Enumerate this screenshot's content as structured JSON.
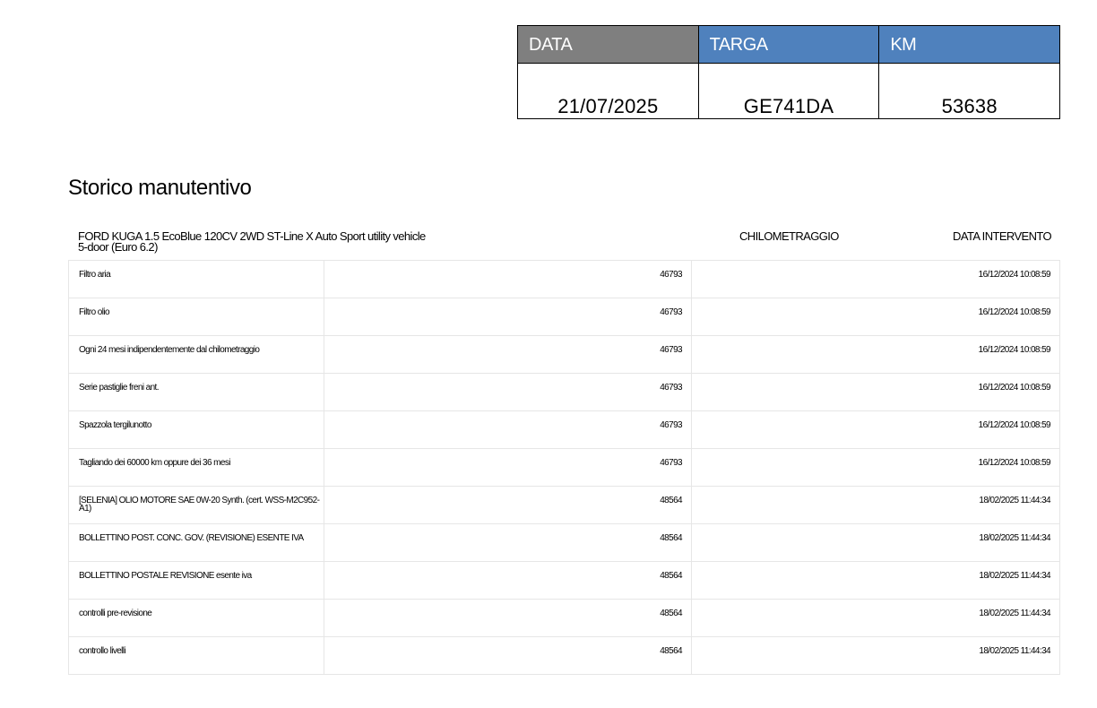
{
  "summary": {
    "date_label": "DATA",
    "plate_label": "TARGA",
    "km_label": "KM",
    "date_value": "21/07/2025",
    "plate_value": "GE741DA",
    "km_value": "53638",
    "colors": {
      "date_header": "#7f7f7f",
      "plate_header": "#4f81bd",
      "km_header": "#4f81bd"
    }
  },
  "section_title": "Storico manutentivo",
  "table": {
    "vehicle": "FORD KUGA 1.5 EcoBlue 120CV 2WD ST-Line X Auto Sport utility vehicle 5-door (Euro 6.2)",
    "km_header": "CHILOMETRAGGIO",
    "date_header": "DATA INTERVENTO",
    "rows": [
      {
        "description": "Filtro aria",
        "km": "46793",
        "date": "16/12/2024 10:08:59"
      },
      {
        "description": "Filtro olio",
        "km": "46793",
        "date": "16/12/2024 10:08:59"
      },
      {
        "description": "Ogni 24 mesi indipendentemente dal chilometraggio",
        "km": "46793",
        "date": "16/12/2024 10:08:59"
      },
      {
        "description": "Serie pastiglie freni ant.",
        "km": "46793",
        "date": "16/12/2024 10:08:59"
      },
      {
        "description": "Spazzola tergilunotto",
        "km": "46793",
        "date": "16/12/2024 10:08:59"
      },
      {
        "description": "Tagliando dei 60000 km oppure dei 36 mesi",
        "km": "46793",
        "date": "16/12/2024 10:08:59"
      },
      {
        "description": "[SELENIA] OLIO MOTORE SAE 0W-20 Synth. (cert. WSS-M2C952-A1)",
        "km": "48564",
        "date": "18/02/2025 11:44:34"
      },
      {
        "description": "BOLLETTINO POST. CONC. GOV. (REVISIONE) ESENTE IVA",
        "km": "48564",
        "date": "18/02/2025 11:44:34"
      },
      {
        "description": "BOLLETTINO POSTALE REVISIONE esente iva",
        "km": "48564",
        "date": "18/02/2025 11:44:34"
      },
      {
        "description": "controlli pre-revisione",
        "km": "48564",
        "date": "18/02/2025 11:44:34"
      },
      {
        "description": "controllo livelli",
        "km": "48564",
        "date": "18/02/2025 11:44:34"
      }
    ]
  }
}
